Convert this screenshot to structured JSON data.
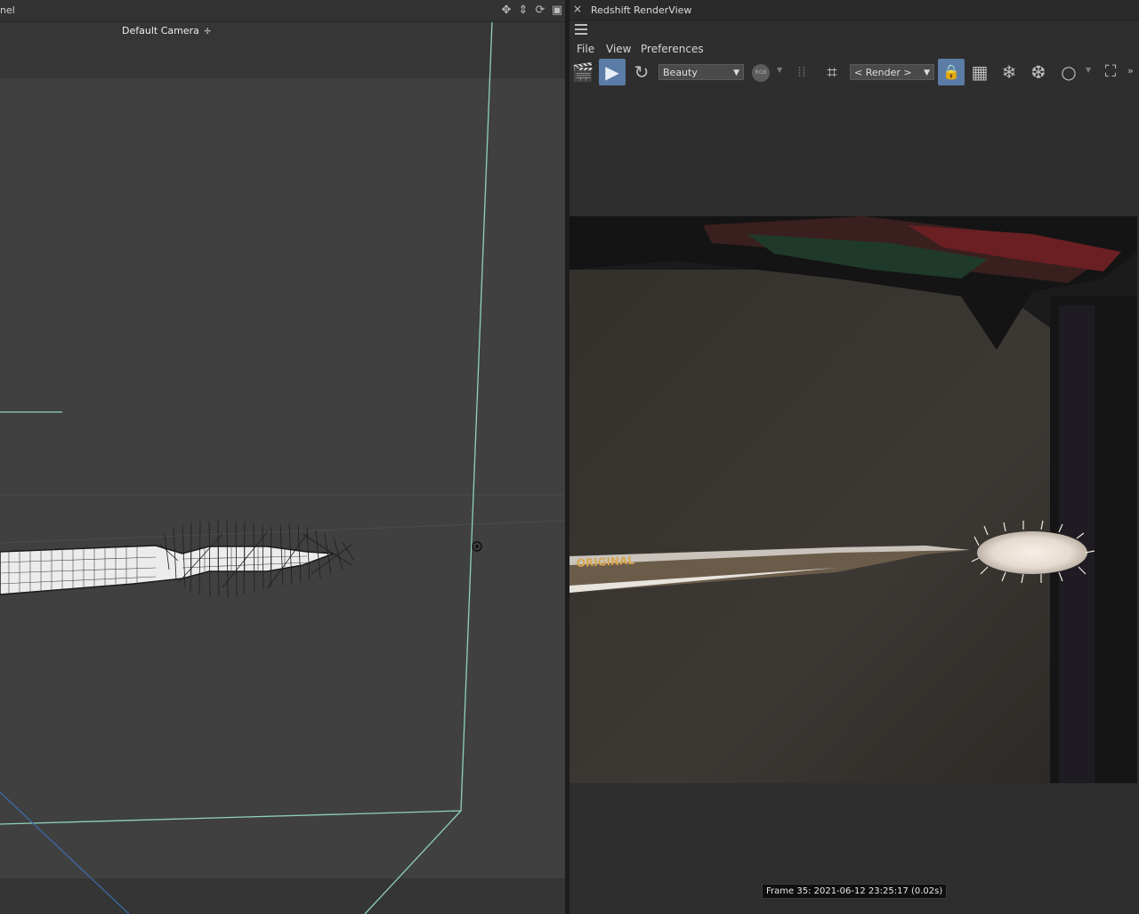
{
  "viewport": {
    "title": "nel",
    "camera_label": "Default Camera",
    "camera_icon": "camera-pin-icon",
    "nav_icons": [
      "move-icon",
      "pan-icon",
      "rotate-icon",
      "maximize-icon"
    ]
  },
  "render_view": {
    "title": "Redshift RenderView",
    "close_glyph": "×",
    "menu": [
      "File",
      "View",
      "Preferences"
    ],
    "aov_select": "Beauty",
    "render_select": "< Render >",
    "rgb_label": "RGB",
    "frame_info": "Frame  35:  2021-06-12  23:25:17  (0.02s)",
    "colors": {
      "active_button": "#5a7ca6",
      "viewport_bg": "#404040",
      "safe_frame": "#8fd1bd"
    }
  }
}
